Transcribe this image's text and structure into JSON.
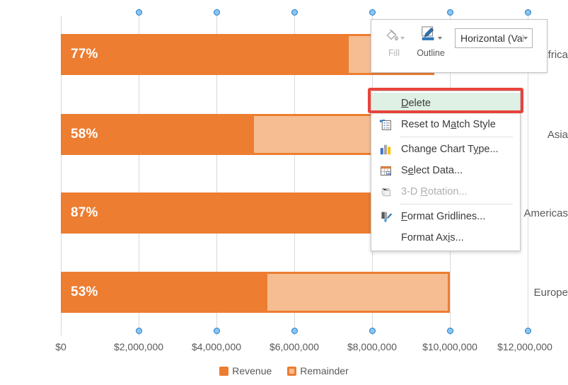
{
  "chart_data": {
    "type": "bar",
    "orientation": "horizontal",
    "stacked": true,
    "title": "",
    "xlabel": "",
    "ylabel": "",
    "categories": [
      "Africa",
      "Asia",
      "Americas",
      "Europe"
    ],
    "series": [
      {
        "name": "Revenue",
        "values": [
          7400000,
          5300000,
          8700000,
          5300000
        ]
      },
      {
        "name": "Remainder",
        "values": [
          2200000,
          3800000,
          1300000,
          4700000
        ]
      }
    ],
    "totals": [
      9600000,
      9100000,
      10000000,
      10000000
    ],
    "data_labels": [
      "77%",
      "58%",
      "87%",
      "53%"
    ],
    "xlim": [
      0,
      12000000
    ],
    "xticks": [
      {
        "value": 0,
        "label": "$0"
      },
      {
        "value": 2000000,
        "label": "$2,000,000"
      },
      {
        "value": 4000000,
        "label": "$4,000,000"
      },
      {
        "value": 6000000,
        "label": "$6,000,000"
      },
      {
        "value": 8000000,
        "label": "$8,000,000"
      },
      {
        "value": 10000000,
        "label": "$10,000,000"
      },
      {
        "value": 12000000,
        "label": "$12,000,000"
      }
    ],
    "grid": true,
    "legend_position": "bottom",
    "legend": [
      "Revenue",
      "Remainder"
    ],
    "colors": {
      "revenue": "#ed7d31",
      "remainder_fill": "#f6bd92",
      "remainder_border": "#ed7d31",
      "gridline": "#d9d9d9",
      "axis_text": "#595959",
      "data_label": "#ffffff"
    },
    "selection": {
      "selected_element": "Horizontal (Value) Axis Major Gridlines",
      "handle_color": "#1a7ed1"
    }
  },
  "mini_toolbar": {
    "fill": {
      "label": "Fill",
      "icon": "fill-bucket-icon",
      "enabled": false
    },
    "outline": {
      "label": "Outline",
      "icon": "outline-pen-icon",
      "enabled": true,
      "color": "#2e75b6"
    },
    "chart_element_select": {
      "value": "Horizontal (Val",
      "icon": "chevron-down-icon"
    }
  },
  "context_menu": {
    "items": [
      {
        "label": "Delete",
        "accel": "D",
        "icon": "none",
        "enabled": true,
        "highlighted": true,
        "separator_after": false
      },
      {
        "label": "Reset to Match Style",
        "accel": "a",
        "icon": "reset-style-icon",
        "enabled": true,
        "highlighted": false,
        "separator_after": true
      },
      {
        "label": "Change Chart Type...",
        "accel": "y",
        "icon": "bar-chart-icon",
        "enabled": true,
        "highlighted": false,
        "separator_after": false
      },
      {
        "label": "Select Data...",
        "accel": "e",
        "icon": "select-data-icon",
        "enabled": true,
        "highlighted": false,
        "separator_after": false
      },
      {
        "label": "3-D Rotation...",
        "accel": "R",
        "icon": "cube-3d-icon",
        "enabled": false,
        "highlighted": false,
        "separator_after": true
      },
      {
        "label": "Format Gridlines...",
        "accel": "F",
        "icon": "paintbrush-icon",
        "enabled": true,
        "highlighted": false,
        "separator_after": false
      },
      {
        "label": "Format Axis...",
        "accel": "i",
        "icon": "none",
        "enabled": true,
        "highlighted": false,
        "separator_after": false
      }
    ],
    "annotation_color": "#e8433c"
  }
}
